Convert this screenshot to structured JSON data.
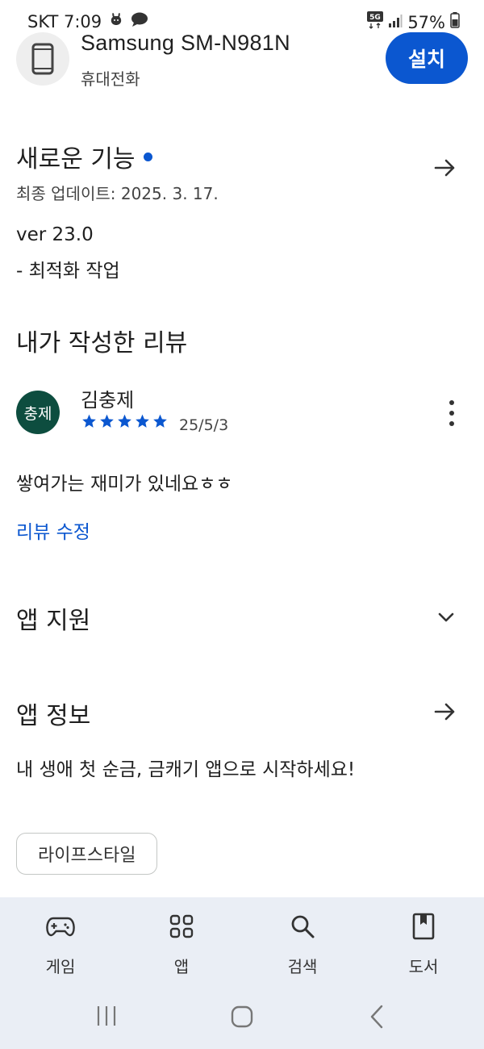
{
  "status_bar": {
    "carrier_time": "SKT 7:09",
    "network": "5G",
    "battery": "57%"
  },
  "app": {
    "name": "Samsung SM-N981N",
    "device_type": "휴대전화",
    "install_label": "설치"
  },
  "whats_new": {
    "title": "새로운 기능",
    "updated": "최종 업데이트: 2025. 3. 17.",
    "version": "ver 23.0",
    "change": "- 최적화 작업"
  },
  "my_review": {
    "title": "내가 작성한 리뷰",
    "avatar_text": "충제",
    "name": "김충제",
    "rating": 5,
    "date": "25/5/3",
    "text": "쌓여가는 재미가  있네요ㅎㅎ",
    "edit_label": "리뷰 수정"
  },
  "app_support": {
    "title": "앱 지원"
  },
  "app_info": {
    "title": "앱 정보",
    "description": "내 생애 첫 순금, 금캐기 앱으로 시작하세요!",
    "category": "라이프스타일"
  },
  "bottom_nav": {
    "games": "게임",
    "apps": "앱",
    "search": "검색",
    "books": "도서"
  },
  "colors": {
    "accent": "#0b57d0",
    "avatar_bg": "#0d4d3f",
    "nav_bg": "#eaeef5"
  }
}
